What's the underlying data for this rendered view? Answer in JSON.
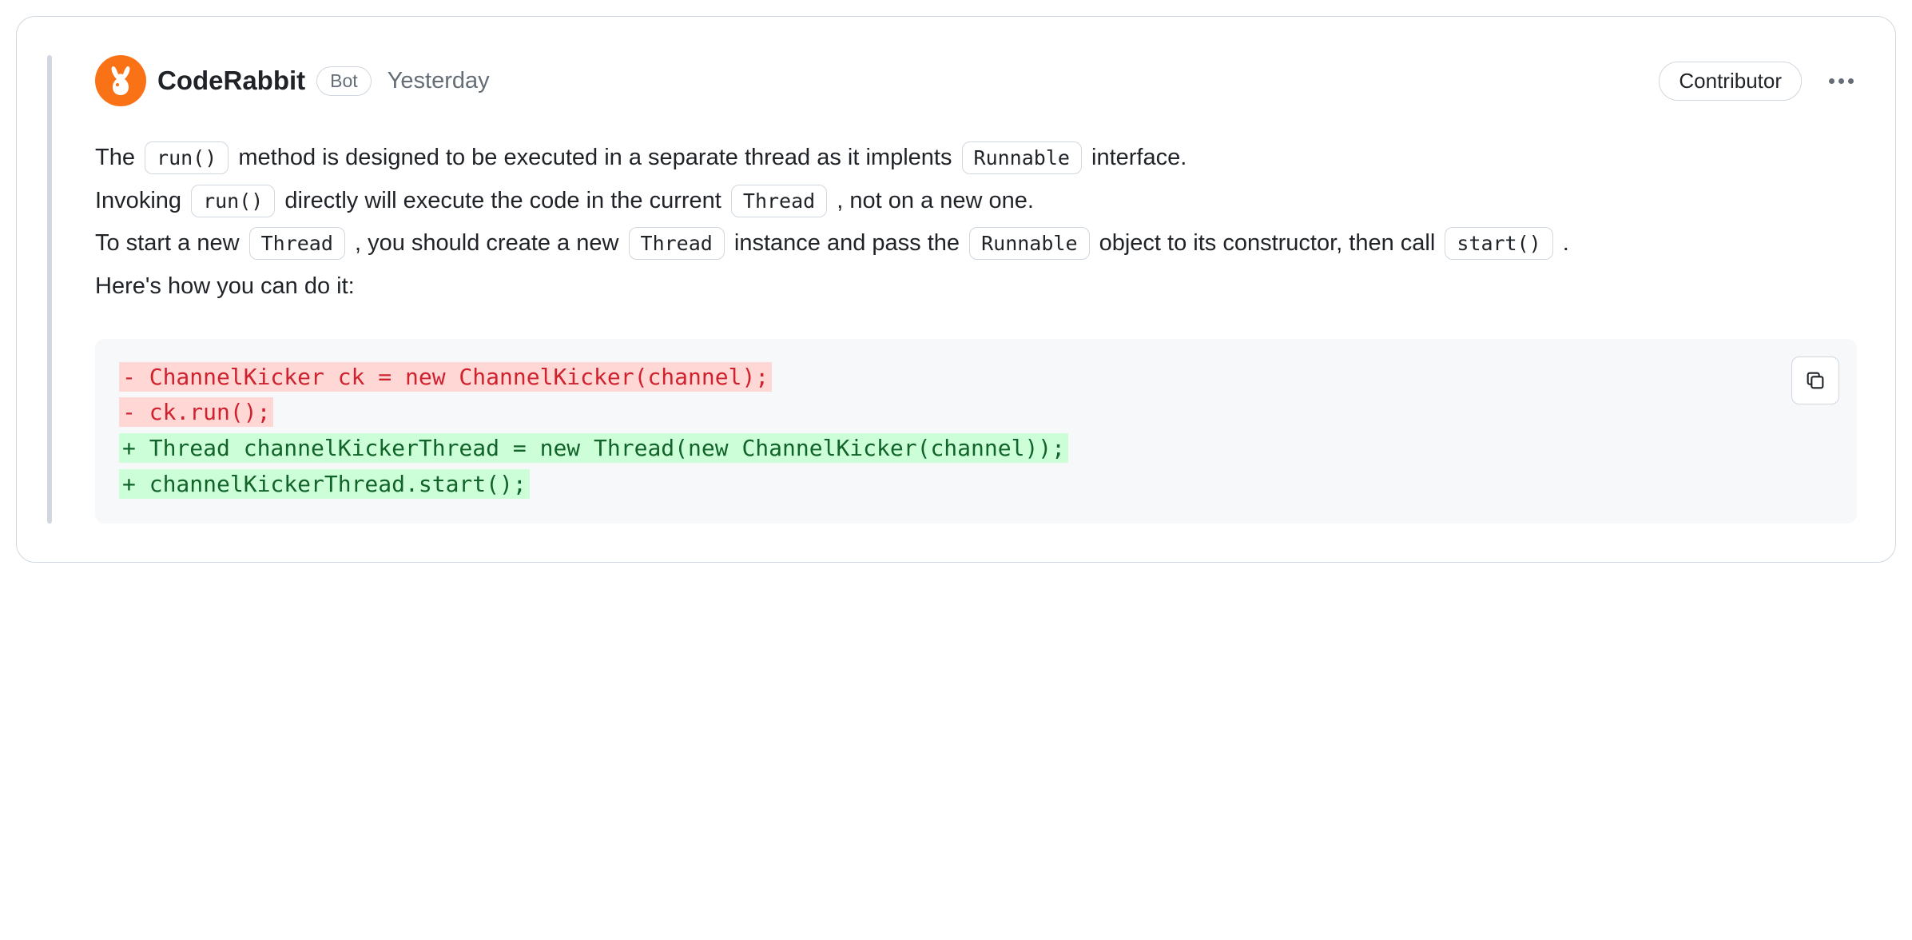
{
  "author": {
    "name": "CodeRabbit",
    "badge": "Bot",
    "timestamp": "Yesterday",
    "role": "Contributor"
  },
  "body": {
    "p1_part1": "The ",
    "p1_code1": "run()",
    "p1_part2": " method is designed to be executed in a separate thread as it implents ",
    "p1_code2": "Runnable",
    "p1_part3": " interface.",
    "p2_part1": "Invoking ",
    "p2_code1": "run()",
    "p2_part2": " directly will execute the code in the current ",
    "p2_code2": "Thread",
    "p2_part3": " , not on a new one.",
    "p3_part1": "To start a new ",
    "p3_code1": "Thread",
    "p3_part2": " , you should create a new ",
    "p3_code2": "Thread",
    "p3_part3": " instance and pass the ",
    "p3_code3": "Runnable",
    "p3_part4": " object to its constructor, then call ",
    "p3_code4": "start()",
    "p3_part5": " .",
    "p4": "Here's how you can do it:"
  },
  "diff": {
    "remove1": "- ChannelKicker ck = new ChannelKicker(channel);",
    "remove2": "- ck.run();",
    "add1": "+ Thread channelKickerThread = new Thread(new ChannelKicker(channel));",
    "add2": "+ channelKickerThread.start();"
  }
}
